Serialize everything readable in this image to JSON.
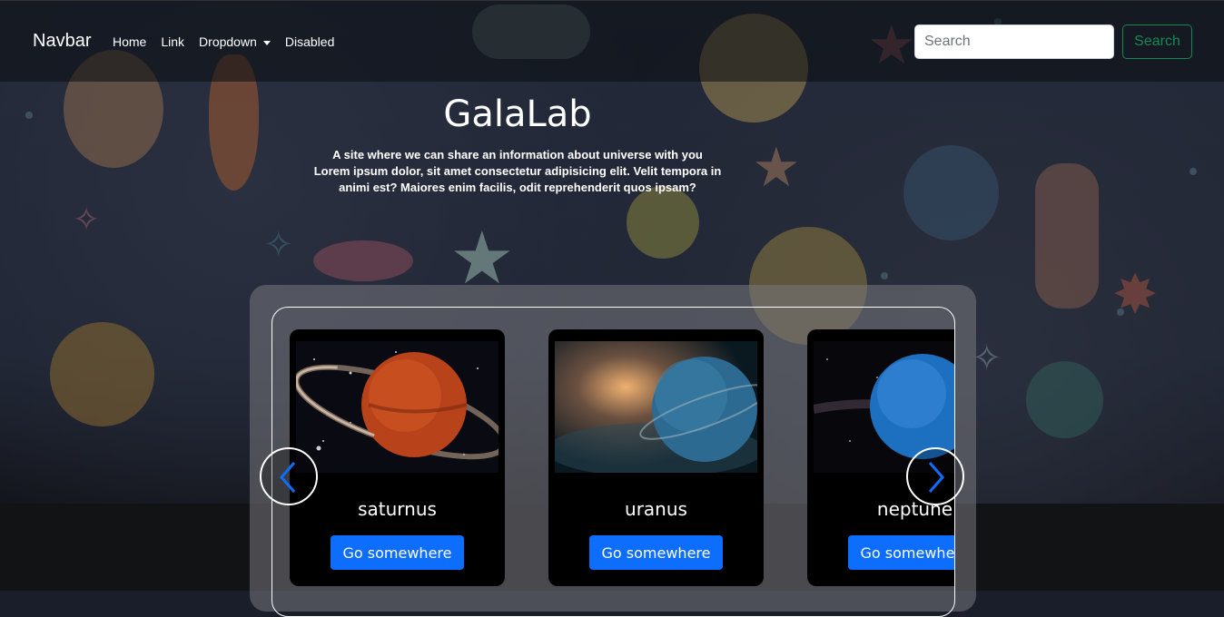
{
  "navbar": {
    "brand": "Navbar",
    "links": [
      {
        "label": "Home"
      },
      {
        "label": "Link"
      },
      {
        "label": "Dropdown"
      },
      {
        "label": "Disabled"
      }
    ],
    "search": {
      "placeholder": "Search",
      "button_label": "Search"
    }
  },
  "hero": {
    "title": "GalaLab",
    "line1": "A site where we can share an information about universe with you",
    "line2": "Lorem ipsum dolor, sit amet consectetur adipisicing elit. Velit tempora in",
    "line3": "animi est? Maiores enim facilis, odit reprehenderit quos ipsam?"
  },
  "carousel": {
    "cards": [
      {
        "title": "saturnus",
        "button": "Go somewhere"
      },
      {
        "title": "uranus",
        "button": "Go somewhere"
      },
      {
        "title": "neptune",
        "button": "Go somewhere"
      }
    ],
    "prev_icon": "chevron-left-icon",
    "next_icon": "chevron-right-icon"
  },
  "colors": {
    "accent_blue": "#0d6efd",
    "search_green": "#198754"
  }
}
